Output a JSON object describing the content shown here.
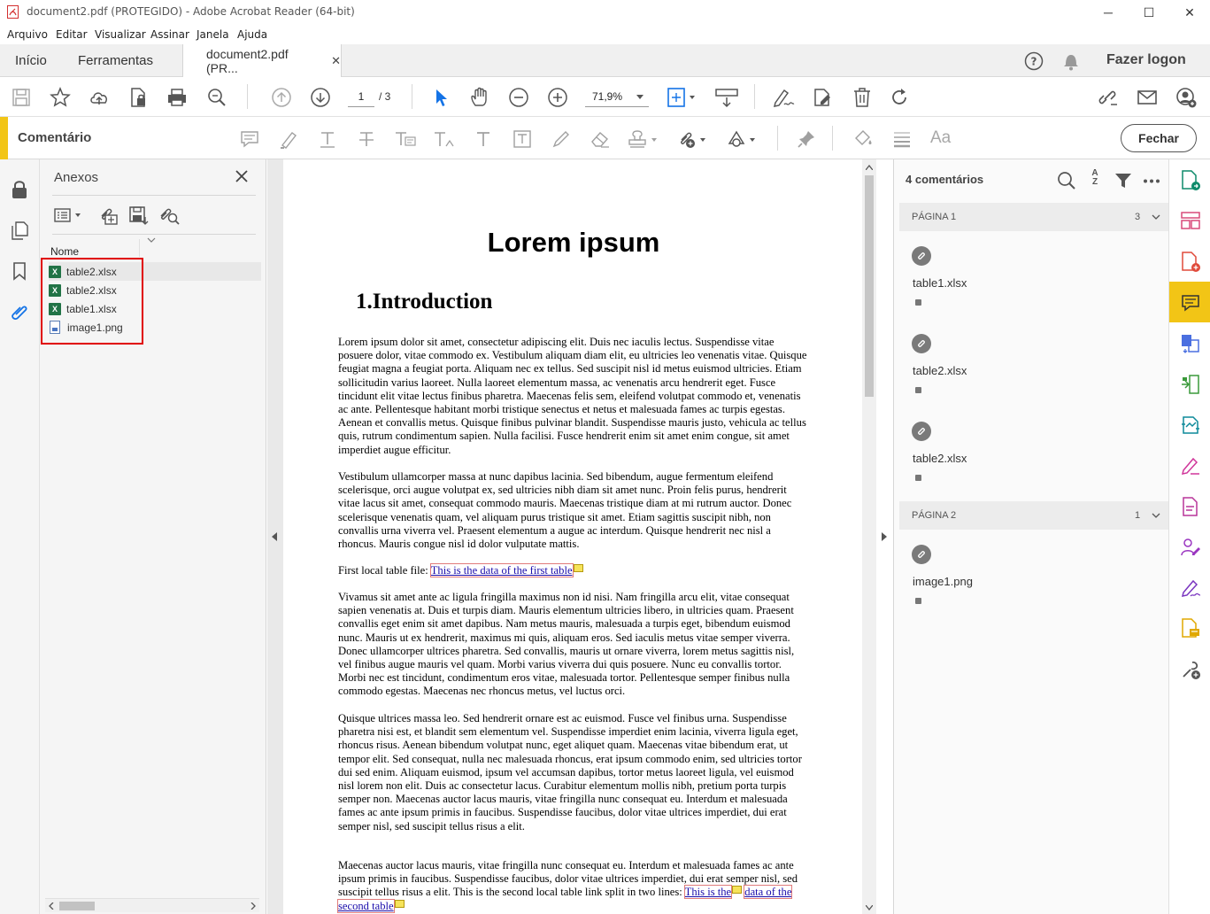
{
  "window": {
    "title": "document2.pdf (PROTEGIDO) - Adobe Acrobat Reader (64-bit)",
    "minimize": "─",
    "maximize": "☐",
    "close": "✕"
  },
  "menu": [
    "Arquivo",
    "Editar",
    "Visualizar",
    "Assinar",
    "Janela",
    "Ajuda"
  ],
  "tabs": {
    "home": "Início",
    "tools": "Ferramentas",
    "document": "document2.pdf (PR...",
    "document_close": "✕",
    "login": "Fazer logon"
  },
  "toolbar": {
    "page_current": "1",
    "page_total": "/ 3",
    "zoom": "71,9%"
  },
  "comment_bar": {
    "title": "Comentário",
    "close_label": "Fechar",
    "font_label": "Aa"
  },
  "attachments": {
    "title": "Anexos",
    "column_name": "Nome",
    "files": [
      {
        "name": "table2.xlsx",
        "type": "xlsx"
      },
      {
        "name": "table2.xlsx",
        "type": "xlsx"
      },
      {
        "name": "table1.xlsx",
        "type": "xlsx"
      },
      {
        "name": "image1.png",
        "type": "png"
      }
    ]
  },
  "document": {
    "title": "Lorem ipsum",
    "heading": "1.Introduction",
    "p1": "Lorem ipsum dolor sit amet, consectetur adipiscing elit. Duis nec iaculis lectus. Suspendisse vitae posuere dolor, vitae commodo ex. Vestibulum aliquam diam elit, eu ultricies leo venenatis vitae. Quisque feugiat magna a feugiat porta. Aliquam nec ex tellus. Sed suscipit nisl id metus euismod ultricies. Etiam sollicitudin varius laoreet. Nulla laoreet elementum massa, ac venenatis arcu hendrerit eget. Fusce tincidunt elit vitae lectus finibus pharetra. Maecenas felis sem, eleifend volutpat commodo et, venenatis ac ante. Pellentesque habitant morbi tristique senectus et netus et malesuada fames ac turpis egestas. Aenean et convallis metus. Quisque finibus pulvinar blandit. Suspendisse mauris justo, vehicula ac tellus quis, rutrum condimentum sapien. Nulla facilisi. Fusce hendrerit enim sit amet enim congue, sit amet imperdiet augue efficitur.",
    "p2": "Vestibulum ullamcorper massa at nunc dapibus lacinia. Sed bibendum, augue fermentum eleifend scelerisque, orci augue volutpat ex, sed ultricies nibh diam sit amet nunc. Proin felis purus, hendrerit vitae lacus sit amet, consequat commodo mauris. Maecenas tristique diam at mi rutrum auctor. Donec scelerisque venenatis quam, vel aliquam purus tristique sit amet. Etiam sagittis suscipit nibh, non convallis urna viverra vel. Praesent elementum a augue ac interdum. Quisque hendrerit nec nisl a rhoncus. Mauris congue nisl id dolor vulputate mattis.",
    "first_table_prefix": "First local table file: ",
    "first_table_link": "This is the data of the first table",
    "p3": "Vivamus sit amet ante ac ligula fringilla maximus non id nisi. Nam fringilla arcu elit, vitae consequat sapien venenatis at. Duis et turpis diam. Mauris elementum ultricies libero, in ultricies quam. Praesent convallis eget enim sit amet dapibus. Nam metus mauris, malesuada a turpis eget, bibendum euismod nunc. Mauris ut ex hendrerit, maximus mi quis, aliquam eros. Sed iaculis metus vitae semper viverra. Donec ullamcorper ultrices pharetra. Sed convallis, mauris ut ornare viverra, lorem metus sagittis nisl, vel finibus augue mauris vel quam. Morbi varius viverra dui quis posuere. Nunc eu convallis tortor. Morbi nec est tincidunt, condimentum eros vitae, malesuada tortor. Pellentesque semper finibus nulla commodo egestas. Maecenas nec rhoncus metus, vel luctus orci.",
    "p4": "Quisque ultrices massa leo. Sed hendrerit ornare est ac euismod. Fusce vel finibus urna. Suspendisse pharetra nisi est, et blandit sem elementum vel. Suspendisse imperdiet enim lacinia, viverra ligula eget, rhoncus risus. Aenean bibendum volutpat nunc, eget aliquet quam. Maecenas vitae bibendum erat, ut tempor elit. Sed consequat, nulla nec malesuada rhoncus, erat ipsum commodo enim, sed ultricies tortor dui sed enim. Aliquam euismod, ipsum vel accumsan dapibus, tortor metus laoreet ligula, vel euismod nisl lorem non elit. Duis ac consectetur lacus. Curabitur elementum mollis nibh, pretium porta turpis semper non. Maecenas auctor lacus mauris, vitae fringilla nunc consequat eu. Interdum et malesuada fames ac ante ipsum primis in faucibus. Suspendisse faucibus, dolor vitae ultrices imperdiet, dui erat semper nisl, sed suscipit tellus risus a elit.",
    "p5": "Maecenas auctor lacus mauris, vitae fringilla nunc consequat eu. Interdum et malesuada fames ac ante ipsum primis in faucibus. Suspendisse faucibus, dolor vitae ultrices imperdiet, dui erat semper nisl, sed suscipit tellus risus a elit. This is the second local table link split in two lines: ",
    "second_table_link_a": "This is the",
    "second_table_link_b": "data of the second table"
  },
  "comments": {
    "count_label": "4 comentários",
    "sort_label": "A Z",
    "groups": [
      {
        "label": "PÁGINA 1",
        "count": "3",
        "items": [
          "table1.xlsx",
          "table2.xlsx",
          "table2.xlsx"
        ]
      },
      {
        "label": "PÁGINA 2",
        "count": "1",
        "items": [
          "image1.png"
        ]
      }
    ]
  },
  "colors": {
    "accent": "#f2c516",
    "highlight_box": "#e00000",
    "link": "#1a0dab"
  }
}
